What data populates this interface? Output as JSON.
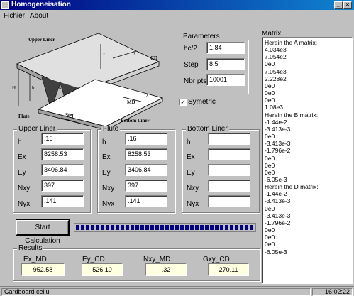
{
  "window": {
    "title": "Homogeneisation",
    "minimize_icon": "minimize-icon",
    "close_icon": "close-icon"
  },
  "menu": {
    "items": [
      "Fichier",
      "About"
    ]
  },
  "diagram": {
    "labels": {
      "upper_liner": "Upper Liner",
      "z_axis": "z",
      "y_axis": "y",
      "cd": "CD",
      "h_big": "H",
      "h_small": "h",
      "flute": "Flute",
      "step": "Step",
      "x_axis": "x",
      "md": "MD",
      "bottom_liner": "Bottom Liner"
    }
  },
  "parameters": {
    "title": "Parameters",
    "rows": [
      {
        "label": "hc/2",
        "value": "1.84"
      },
      {
        "label": "Step",
        "value": "8.5"
      },
      {
        "label": "Nbr pts",
        "value": "10001"
      }
    ],
    "symetric_label": "Symetric",
    "symetric_checked": true
  },
  "matrix": {
    "title": "Matrix",
    "lines": [
      "Herein the A matrix:",
      "4.034e3",
      "7.054e2",
      "0e0",
      "7.054e3",
      "2.228e2",
      "0e0",
      "0e0",
      "0e0",
      "1.08e3",
      "Herein the B matrix:",
      "-1.44e-2",
      "-3.413e-3",
      "0e0",
      "-3.413e-3",
      "-1.796e-2",
      "0e0",
      "0e0",
      "0e0",
      "-6.05e-3",
      "Herein the D matrix:",
      "-1.44e-2",
      "-3.413e-3",
      "0e0",
      "-3.413e-3",
      "-1.796e-2",
      "0e0",
      "0e0",
      "0e0",
      "-6.05e-3"
    ]
  },
  "groups": [
    {
      "title": "Upper Liner",
      "rows": [
        {
          "label": "h",
          "value": ".16"
        },
        {
          "label": "Ex",
          "value": "8258.53"
        },
        {
          "label": "Ey",
          "value": "3406.84"
        },
        {
          "label": "Nxy",
          "value": "397"
        },
        {
          "label": "Nyx",
          "value": ".141"
        }
      ]
    },
    {
      "title": "Flute",
      "rows": [
        {
          "label": "h",
          "value": ".16"
        },
        {
          "label": "Ex",
          "value": "8258.53"
        },
        {
          "label": "Ey",
          "value": "3406.84"
        },
        {
          "label": "Nxy",
          "value": "397"
        },
        {
          "label": "Nyx",
          "value": ".141"
        }
      ]
    },
    {
      "title": "Bottom Liner",
      "rows": [
        {
          "label": "h",
          "value": ""
        },
        {
          "label": "Ex",
          "value": ""
        },
        {
          "label": "Ey",
          "value": ""
        },
        {
          "label": "Nxy",
          "value": ""
        },
        {
          "label": "Nyx",
          "value": ""
        }
      ]
    }
  ],
  "calc_button": "Start Calculation",
  "progress": {
    "percent": 100,
    "color": "#000080"
  },
  "results": {
    "title": "Results",
    "items": [
      {
        "label": "Ex_MD",
        "value": "952.58"
      },
      {
        "label": "Ey_CD",
        "value": "526.10"
      },
      {
        "label": "Nxy_MD",
        "value": ".32"
      },
      {
        "label": "Gxy_CD",
        "value": "270.11"
      }
    ]
  },
  "status": {
    "text": "Cardboard cellul",
    "time": "16:02:22"
  },
  "colors": {
    "title_start": "#000080",
    "title_end": "#1084d0",
    "result_bg": "#ffffe1",
    "face": "#c0c0c0"
  }
}
